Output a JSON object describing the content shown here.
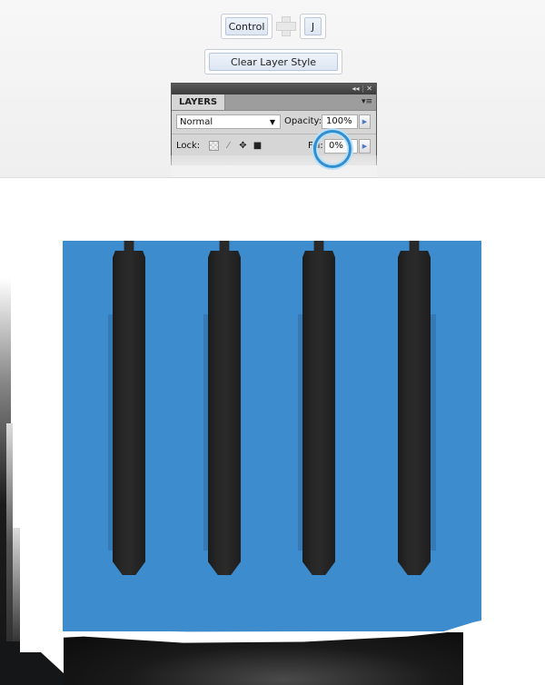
{
  "shortcut": {
    "key1": "Control",
    "plus_icon": "plus-icon",
    "key2": "J"
  },
  "command_button": "Clear Layer Style",
  "layers_panel": {
    "collapse_icon": "◂◂",
    "close_icon": "✕",
    "tab_label": "LAYERS",
    "menu_icon": "▾≡",
    "blend_mode": "Normal",
    "opacity_label": "Opacity:",
    "opacity_value": "100%",
    "lock_label": "Lock:",
    "lock_icons": [
      "lock-transparent-pixels-icon",
      "lock-image-pixels-icon",
      "lock-position-icon",
      "lock-all-icon"
    ],
    "fill_label": "Fill:",
    "fill_value": "0%"
  },
  "highlight": {
    "target": "fill-field",
    "color": "#2f8fd3"
  },
  "canvas": {
    "fill_color": "#3d8ccd",
    "bar_color": "#242424",
    "bar_count": 4
  }
}
